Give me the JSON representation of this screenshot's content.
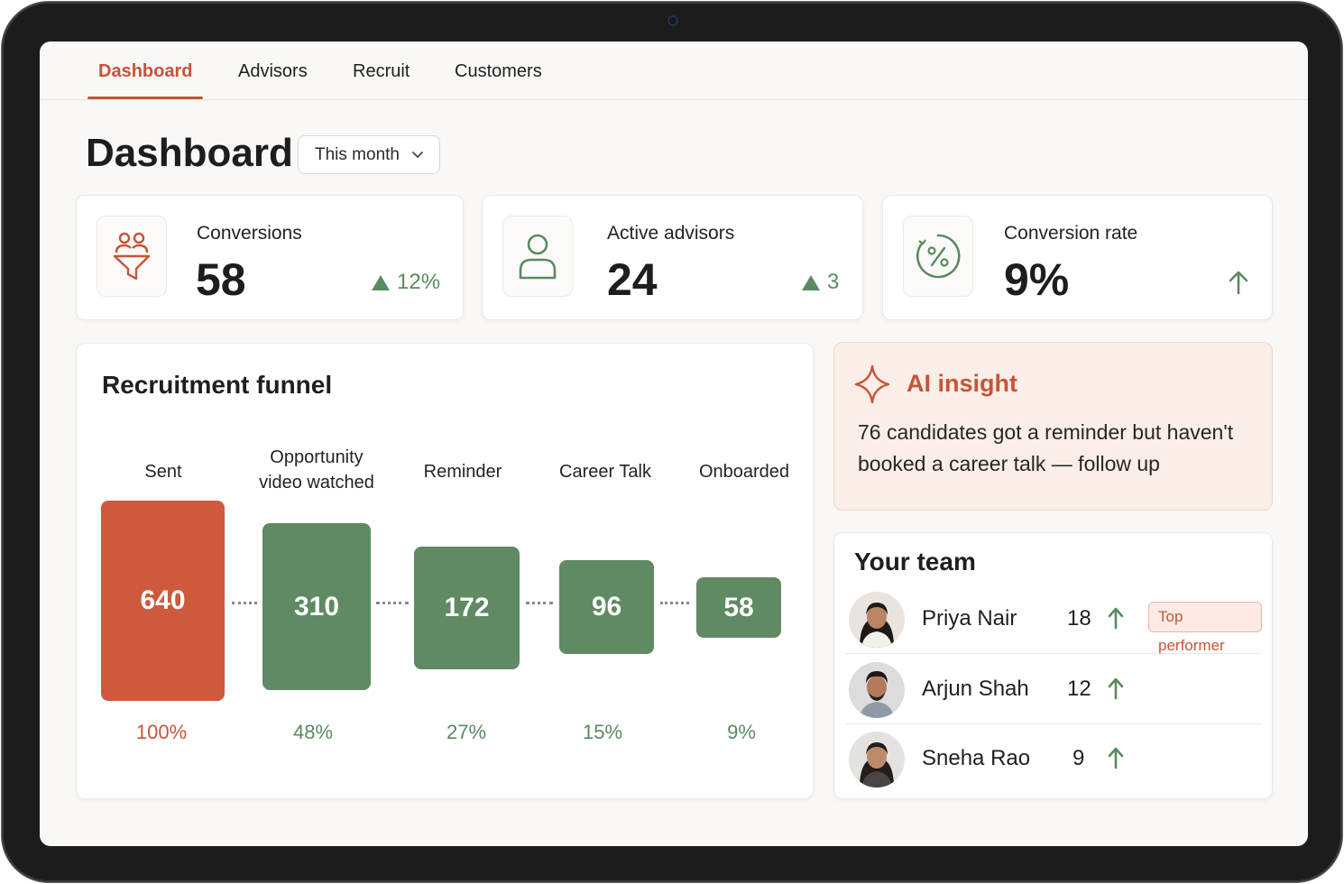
{
  "nav": {
    "tabs": [
      {
        "label": "Dashboard",
        "active": true
      },
      {
        "label": "Advisors",
        "active": false
      },
      {
        "label": "Recruit",
        "active": false
      },
      {
        "label": "Customers",
        "active": false
      }
    ]
  },
  "header": {
    "title": "Dashboard",
    "period": "This month"
  },
  "kpis": [
    {
      "label": "Conversions",
      "value": "58",
      "delta": "12%",
      "icon": "funnel-people-icon"
    },
    {
      "label": "Active advisors",
      "value": "24",
      "delta": "3",
      "icon": "user-icon"
    },
    {
      "label": "Conversion rate",
      "value": "9%",
      "delta": "",
      "icon": "percent-icon"
    }
  ],
  "funnel": {
    "title": "Recruitment funnel",
    "stages": [
      {
        "label_line1": "Sent",
        "label_line2": "",
        "value": "640",
        "percent": "100%"
      },
      {
        "label_line1": "Opportunity",
        "label_line2": "video watched",
        "value": "310",
        "percent": "48%"
      },
      {
        "label_line1": "Reminder",
        "label_line2": "",
        "value": "172",
        "percent": "27%"
      },
      {
        "label_line1": "Career Talk",
        "label_line2": "",
        "value": "96",
        "percent": "15%"
      },
      {
        "label_line1": "Onboarded",
        "label_line2": "",
        "value": "58",
        "percent": "9%"
      }
    ]
  },
  "insight": {
    "title": "AI insight",
    "text": "76 candidates got a reminder but haven't booked a career talk — follow up"
  },
  "team": {
    "title": "Your team",
    "members": [
      {
        "name": "Priya Nair",
        "count": "18",
        "badge": "Top performer"
      },
      {
        "name": "Arjun Shah",
        "count": "12",
        "badge": ""
      },
      {
        "name": "Sneha Rao",
        "count": "9",
        "badge": ""
      }
    ]
  },
  "colors": {
    "accent": "#c65438",
    "positive": "#5a8a60",
    "bar_green": "#5f8a62",
    "bar_orange": "#cd5a3c",
    "insight_bg": "#fbede7"
  }
}
